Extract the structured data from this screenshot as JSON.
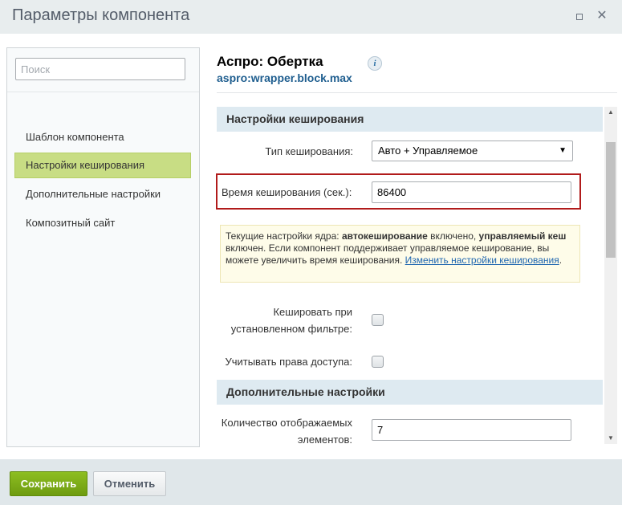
{
  "window": {
    "title": "Параметры компонента",
    "maximize_icon": "maximize-icon",
    "close_icon": "close-icon",
    "close_glyph": "✕"
  },
  "sidebar": {
    "search_placeholder": "Поиск",
    "items": [
      {
        "label": "Шаблон компонента",
        "active": false
      },
      {
        "label": "Настройки кеширования",
        "active": true
      },
      {
        "label": "Дополнительные настройки",
        "active": false
      },
      {
        "label": "Композитный сайт",
        "active": false
      }
    ]
  },
  "main": {
    "title": "Аспро: Обертка",
    "code": "aspro:wrapper.block.max",
    "info_icon": "i",
    "sections": {
      "cache": {
        "heading": "Настройки кеширования",
        "cache_type_label": "Тип кеширования:",
        "cache_type_value": "Авто + Управляемое",
        "cache_time_label": "Время кеширования (сек.):",
        "cache_time_value": "86400",
        "notice": {
          "p1": "Текущие настройки ядра: ",
          "b1": "автокеширование",
          "p2": " включено, ",
          "b2": "управляемый кеш",
          "p3": " включен. Если компонент поддерживает управляемое кеширование, вы можете увеличить время кеширования. ",
          "link": "Изменить настройки кеширования",
          "p4": "."
        },
        "cache_filter_label_1": "Кешировать при",
        "cache_filter_label_2": "установленном фильтре:",
        "cache_groups_label": "Учитывать права доступа:"
      },
      "additional": {
        "heading": "Дополнительные настройки",
        "count_label_1": "Количество отображаемых",
        "count_label_2": "элементов:",
        "count_value": "7"
      }
    }
  },
  "footer": {
    "save_label": "Сохранить",
    "cancel_label": "Отменить"
  },
  "colors": {
    "active_item": "#c8dd84",
    "section_header": "#deeaf1",
    "save_button": "#7aa915",
    "highlight_border": "#b11b1b",
    "notice_bg": "#fefce9"
  }
}
